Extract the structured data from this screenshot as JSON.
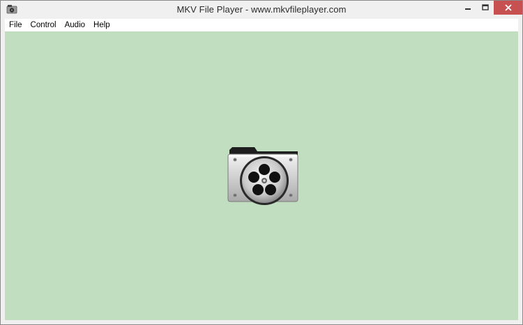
{
  "window": {
    "title": "MKV File Player - www.mkvfileplayer.com",
    "app_icon": "film-reel-icon",
    "controls": [
      "minimize-icon",
      "maximize-icon",
      "close-icon"
    ],
    "close_color": "#c75050"
  },
  "menubar": {
    "items": [
      {
        "label": "File"
      },
      {
        "label": "Control"
      },
      {
        "label": "Audio"
      },
      {
        "label": "Help"
      }
    ]
  },
  "content": {
    "background": "#c1dec0",
    "center_icon": "video-folder-icon"
  }
}
